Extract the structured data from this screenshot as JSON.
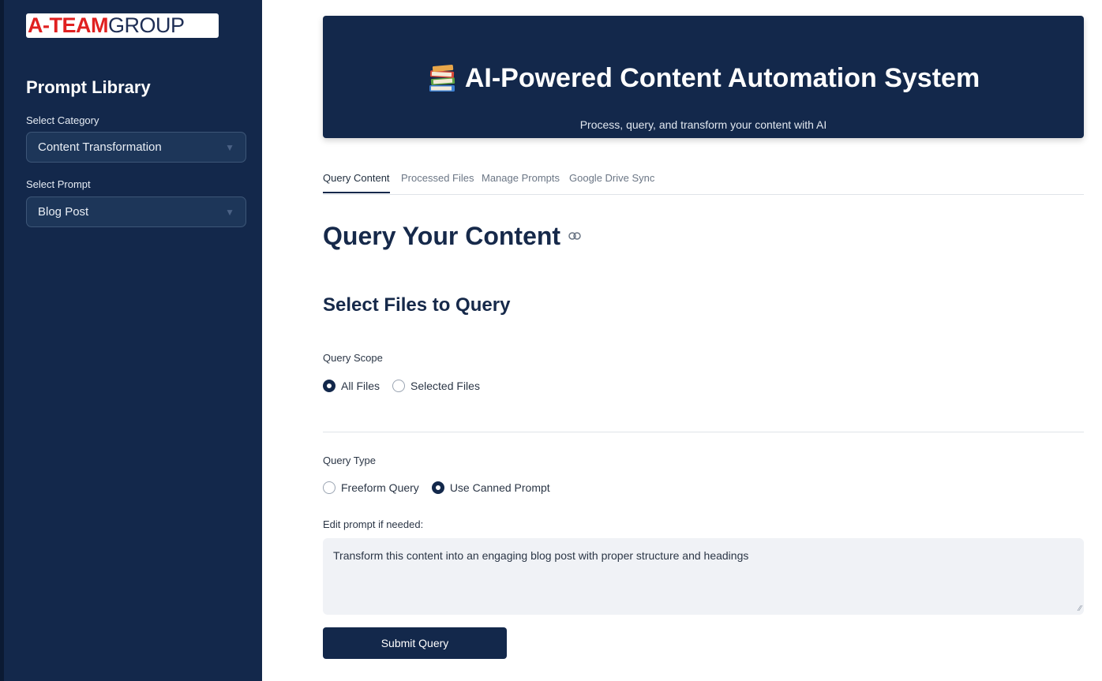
{
  "sidebar": {
    "logo": {
      "part1": "A-TEAM",
      "part2": "GROUP"
    },
    "title": "Prompt Library",
    "category_label": "Select Category",
    "category_value": "Content Transformation",
    "prompt_label": "Select Prompt",
    "prompt_value": "Blog Post"
  },
  "hero": {
    "icon": "books-icon",
    "title": "AI-Powered Content Automation System",
    "subtitle": "Process, query, and transform your content with AI"
  },
  "tabs": [
    {
      "label": "Query Content",
      "active": true
    },
    {
      "label": "Processed Files",
      "active": false
    },
    {
      "label": "Manage Prompts",
      "active": false
    },
    {
      "label": "Google Drive Sync",
      "active": false
    }
  ],
  "main": {
    "heading": "Query Your Content",
    "subheading": "Select Files to Query",
    "scope_label": "Query Scope",
    "scope_options": [
      "All Files",
      "Selected Files"
    ],
    "scope_selected": "All Files",
    "type_label": "Query Type",
    "type_options": [
      "Freeform Query",
      "Use Canned Prompt"
    ],
    "type_selected": "Use Canned Prompt",
    "edit_label": "Edit prompt if needed:",
    "prompt_text": "Transform this content into an engaging blog post with proper structure and headings",
    "submit_label": "Submit Query"
  },
  "colors": {
    "sidebar_bg": "#13284b",
    "accent": "#13284b",
    "logo_red": "#e02020"
  }
}
